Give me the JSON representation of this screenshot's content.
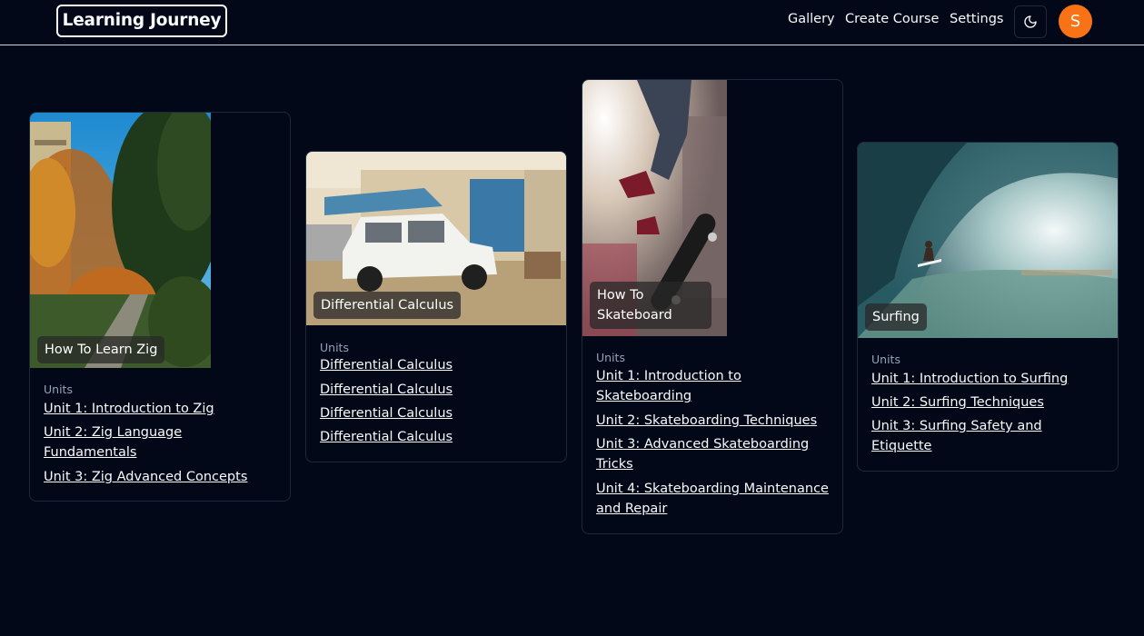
{
  "header": {
    "logo": "Learning Journey",
    "nav": [
      "Gallery",
      "Create Course",
      "Settings"
    ],
    "theme_icon": "moon-icon",
    "avatar_initial": "S",
    "avatar_color": "#f97316"
  },
  "courses": [
    {
      "title": "How To Learn Zig",
      "units_label": "Units",
      "units": [
        "Unit 1: Introduction to Zig",
        "Unit 2: Zig Language Fundamentals",
        "Unit 3: Zig Advanced Concepts"
      ]
    },
    {
      "title": "Differential Calculus",
      "units_label": "Units",
      "units": [
        "Differential Calculus",
        "Differential Calculus",
        "Differential Calculus",
        "Differential Calculus"
      ]
    },
    {
      "title": "How To Skateboard",
      "units_label": "Units",
      "units": [
        "Unit 1: Introduction to Skateboarding",
        "Unit 2: Skateboarding Techniques",
        "Unit 3: Advanced Skateboarding Tricks",
        "Unit 4: Skateboarding Maintenance and Repair"
      ]
    },
    {
      "title": "Surfing",
      "units_label": "Units",
      "units": [
        "Unit 1: Introduction to Surfing",
        "Unit 2: Surfing Techniques",
        "Unit 3: Surfing Safety and Etiquette"
      ]
    }
  ]
}
